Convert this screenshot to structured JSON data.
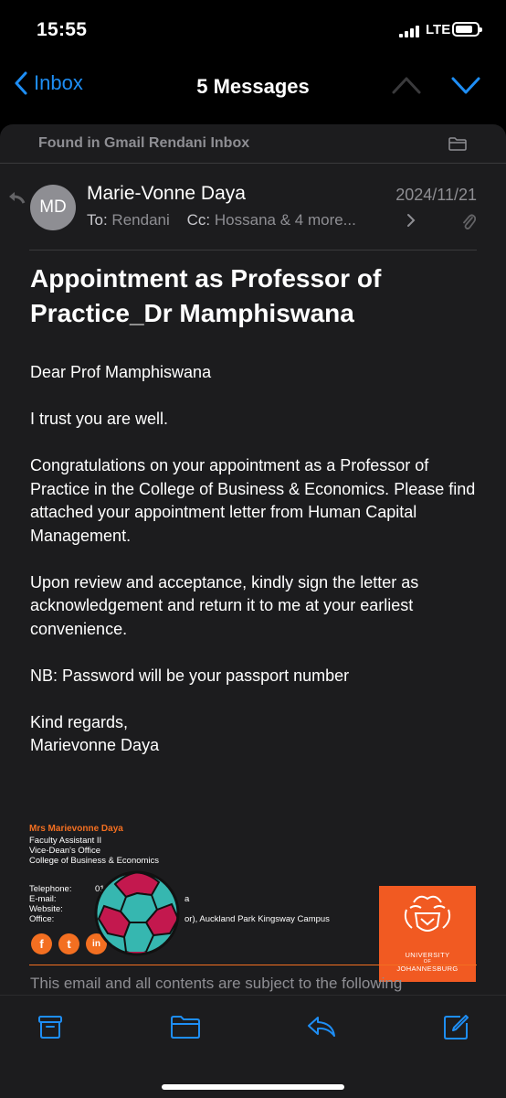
{
  "status_bar": {
    "time": "15:55",
    "network": "LTE"
  },
  "nav": {
    "back_label": "Inbox",
    "title": "5 Messages"
  },
  "banner": {
    "text": "Found in Gmail Rendani Inbox"
  },
  "message": {
    "avatar_initials": "MD",
    "sender": "Marie-Vonne Daya",
    "date": "2024/11/21",
    "to_label": "To:",
    "to": "Rendani",
    "cc_label": "Cc:",
    "cc": "Hossana & 4 more...",
    "subject": "Appointment as Professor of Practice_Dr Mamphiswana",
    "body": [
      "Dear Prof Mamphiswana",
      "I trust you are well.",
      "Congratulations on your appointment as a Professor of Practice in the College of Business & Economics. Please find attached your appointment letter from Human Capital Management.",
      "Upon review and acceptance, kindly sign the letter as acknowledgement and return it to me at your earliest convenience.",
      "NB: Password will be your passport number",
      "Kind regards,",
      "Marievonne Daya"
    ]
  },
  "signature": {
    "name": "Mrs Marievonne Daya",
    "lines": [
      "Faculty Assistant II",
      "Vice-Dean's Office",
      "College of Business & Economics"
    ],
    "contacts": [
      {
        "label": "Telephone:",
        "value": "01"
      },
      {
        "label": "E-mail:",
        "value": "a"
      },
      {
        "label": "Website:",
        "value": ""
      },
      {
        "label": "Office:",
        "value": "or), Auckland Park Kingsway Campus"
      }
    ],
    "logo_text": [
      "UNIVERSITY",
      "OF",
      "JOHANNESBURG"
    ],
    "social": [
      "f",
      "t",
      "in"
    ]
  },
  "footer": {
    "text": "This email and all contents are subject to the following"
  },
  "colors": {
    "accent": "#1e8ef5",
    "brand_orange": "#f15a22"
  }
}
